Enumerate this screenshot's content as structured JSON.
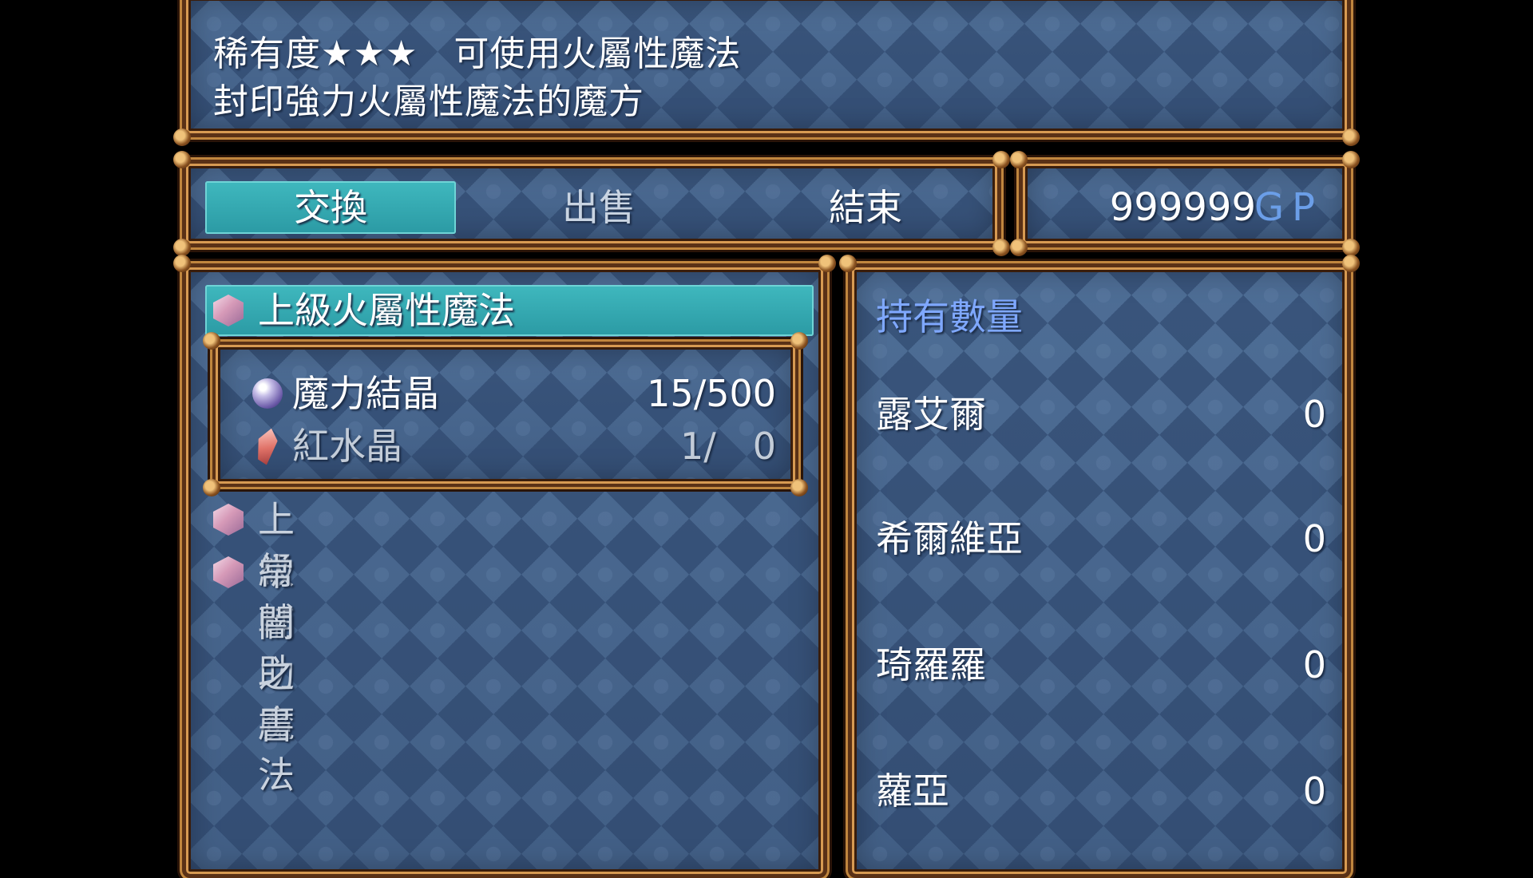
{
  "description": {
    "line1": "稀有度★★★　可使用火屬性魔法",
    "line2": "封印強力火屬性魔法的魔方"
  },
  "commands": [
    {
      "label": "交換",
      "selected": true
    },
    {
      "label": "出售",
      "selected": false
    },
    {
      "label": "結束",
      "selected": false
    }
  ],
  "gold": {
    "value": "999999",
    "unit": "GP"
  },
  "items": [
    {
      "label": "上級火屬性魔法",
      "icon": "cube-gem-icon",
      "selected": true
    },
    {
      "label": "上級輔助魔法",
      "icon": "cube-gem-icon",
      "selected": false
    },
    {
      "label": "常闇之書",
      "icon": "cube-gem-icon",
      "selected": false
    }
  ],
  "ingredients": [
    {
      "name": "魔力結晶",
      "qty": "15/500",
      "icon": "mana-orb-icon"
    },
    {
      "name": "紅水晶",
      "qty": "1/　0",
      "icon": "red-crystal-icon"
    }
  ],
  "owned": {
    "title": "持有數量",
    "characters": [
      {
        "name": "露艾爾",
        "count": "0"
      },
      {
        "name": "希爾維亞",
        "count": "0"
      },
      {
        "name": "琦羅羅",
        "count": "0"
      },
      {
        "name": "蘿亞",
        "count": "0"
      }
    ]
  },
  "colors": {
    "highlight": "#3fb8be",
    "frame": "#c0863e",
    "panel": "#4a6a92",
    "accent_blue": "#7fa8ff"
  }
}
